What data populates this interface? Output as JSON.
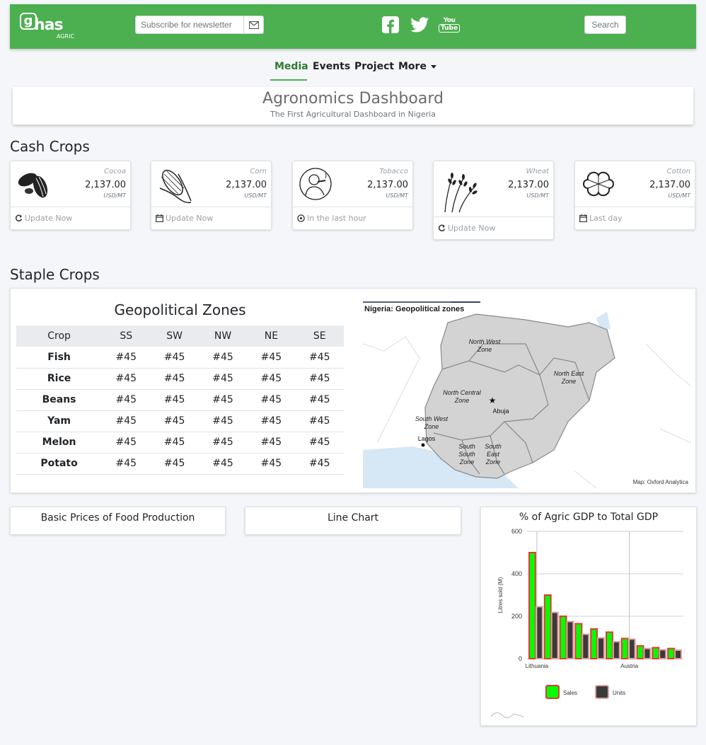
{
  "header": {
    "logo_text": "has",
    "logo_sub": "AGRIC",
    "subscribe_placeholder": "Subscribe for newsletter",
    "search_label": "Search"
  },
  "nav": {
    "items": [
      "Media",
      "Events",
      "Project",
      "More"
    ]
  },
  "dashboard": {
    "title": "Agronomics Dashboard",
    "subtitle": "The First Agricultural Dashboard in Nigeria"
  },
  "cash_crops": {
    "title": "Cash Crops",
    "cards": [
      {
        "name": "Cocoa",
        "price": "2,137.00",
        "unit": "USD/MT",
        "footer": "Update Now",
        "icon": "refresh-icon"
      },
      {
        "name": "Corn",
        "price": "2,137.00",
        "unit": "USD/MT",
        "footer": "Update Now",
        "icon": "calendar-icon"
      },
      {
        "name": "Tobacco",
        "price": "2,137.00",
        "unit": "USD/MT",
        "footer": "In the last hour",
        "icon": "clock-icon"
      },
      {
        "name": "Wheat",
        "price": "2,137.00",
        "unit": "USD/MT",
        "footer": "Update Now",
        "icon": "refresh-icon"
      },
      {
        "name": "Cotton",
        "price": "2,137.00",
        "unit": "USD/MT",
        "footer": "Last day",
        "icon": "calendar-icon"
      }
    ]
  },
  "staple": {
    "title": "Staple Crops",
    "zones_title": "Geopolitical Zones",
    "columns": [
      "Crop",
      "SS",
      "SW",
      "NW",
      "NE",
      "SE"
    ],
    "rows": [
      [
        "Fish",
        "#45",
        "#45",
        "#45",
        "#45",
        "#45"
      ],
      [
        "Rice",
        "#45",
        "#45",
        "#45",
        "#45",
        "#45"
      ],
      [
        "Beans",
        "#45",
        "#45",
        "#45",
        "#45",
        "#45"
      ],
      [
        "Yam",
        "#45",
        "#45",
        "#45",
        "#45",
        "#45"
      ],
      [
        "Melon",
        "#45",
        "#45",
        "#45",
        "#45",
        "#45"
      ],
      [
        "Potato",
        "#45",
        "#45",
        "#45",
        "#45",
        "#45"
      ]
    ],
    "map": {
      "title": "Nigeria: Geopolitical zones",
      "credit": "Map: Oxford Analytica",
      "labels": {
        "nw": [
          "North West",
          "Zone"
        ],
        "ne": [
          "North East",
          "Zone"
        ],
        "nc": [
          "North Central",
          "Zone"
        ],
        "sw": [
          "South West",
          "Zone"
        ],
        "ss": [
          "South",
          "South",
          "Zone"
        ],
        "se": [
          "South",
          "East",
          "Zone"
        ],
        "abuja": "Abuja",
        "lagos": "Lagos"
      }
    }
  },
  "bottom": {
    "basic_prices": "Basic Prices of Food Production",
    "line_chart": "Line Chart",
    "gdp_title": "% of Agric GDP to Total GDP"
  },
  "chart_data": {
    "type": "bar",
    "title": "% of Agric GDP to Total GDP",
    "ylabel": "Litres sold (M)",
    "ylim": [
      0,
      600
    ],
    "yticks": [
      0,
      200,
      400,
      600
    ],
    "x_tick_labels": [
      "Lithuania",
      "Austria"
    ],
    "series": [
      {
        "name": "Sales",
        "color": "#00ff00",
        "edge": "#e53935",
        "values": [
          500,
          300,
          200,
          165,
          140,
          125,
          95,
          60,
          52,
          48
        ]
      },
      {
        "name": "Units",
        "color": "#3a3a3a",
        "edge": "#e0a0a0",
        "values": [
          245,
          218,
          175,
          115,
          98,
          80,
          92,
          48,
          42,
          40
        ]
      }
    ],
    "grid": true,
    "legend": "bottom"
  }
}
